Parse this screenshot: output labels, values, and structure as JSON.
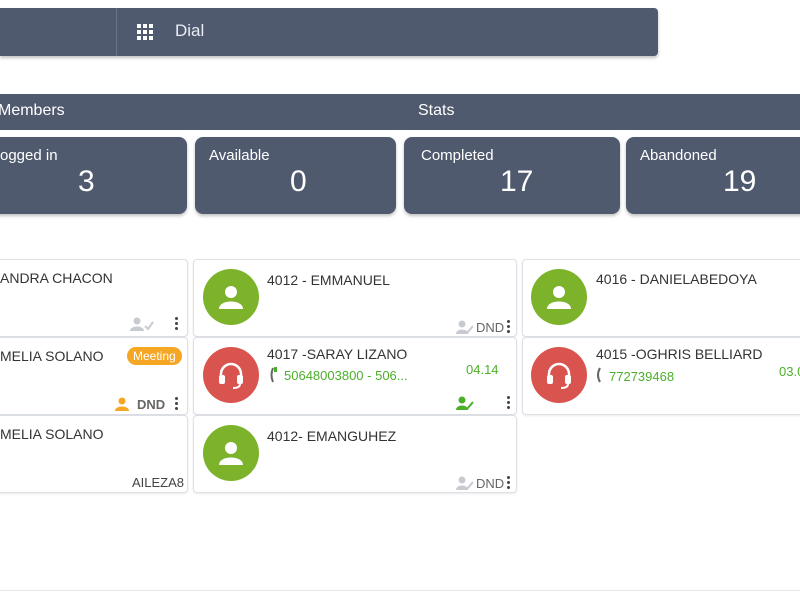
{
  "toolbar": {
    "dial_label": "Dial",
    "grid_icon": "grid-icon"
  },
  "sections": {
    "members": "Members",
    "stats": "Stats"
  },
  "stats": [
    {
      "label": "ogged in",
      "value": "3"
    },
    {
      "label": "Available",
      "value": "0"
    },
    {
      "label": "Completed",
      "value": "17"
    },
    {
      "label": "Abandoned",
      "value": "19"
    }
  ],
  "members": [
    {
      "name": "ANDRA CHACON",
      "status_icon": "user-check-icon"
    },
    {
      "name": "4012 - EMMANUEL",
      "status": "DND",
      "avatar": "user-icon",
      "avatar_color": "#7cb32b"
    },
    {
      "name": "4016 - DANIELABEDOYA",
      "avatar": "user-icon",
      "avatar_color": "#7cb32b"
    },
    {
      "name": "MELIA SOLANO",
      "badge": "Meeting",
      "status": "DND",
      "badge_color": "#f5a623"
    },
    {
      "name": "4017 -SARAY LIZANO",
      "phone": "50648003800 - 506...",
      "timer": "04.14",
      "avatar": "headset-icon",
      "avatar_color": "#d9534f"
    },
    {
      "name": "4015 -OGHRIS BELLIARD",
      "phone": "772739468",
      "timer": "03.0",
      "avatar": "headset-icon",
      "avatar_color": "#d9534f"
    },
    {
      "name": "MELIA SOLANO",
      "tag": "AILEZA8"
    },
    {
      "name": "4012- EMANGUHEZ",
      "status": "DND",
      "avatar": "user-icon",
      "avatar_color": "#7cb32b"
    }
  ],
  "colors": {
    "header": "#505a6e",
    "available_green": "#7cb32b",
    "busy_red": "#d9534f",
    "phone_green": "#4caf2a",
    "meeting_orange": "#f5a623"
  }
}
